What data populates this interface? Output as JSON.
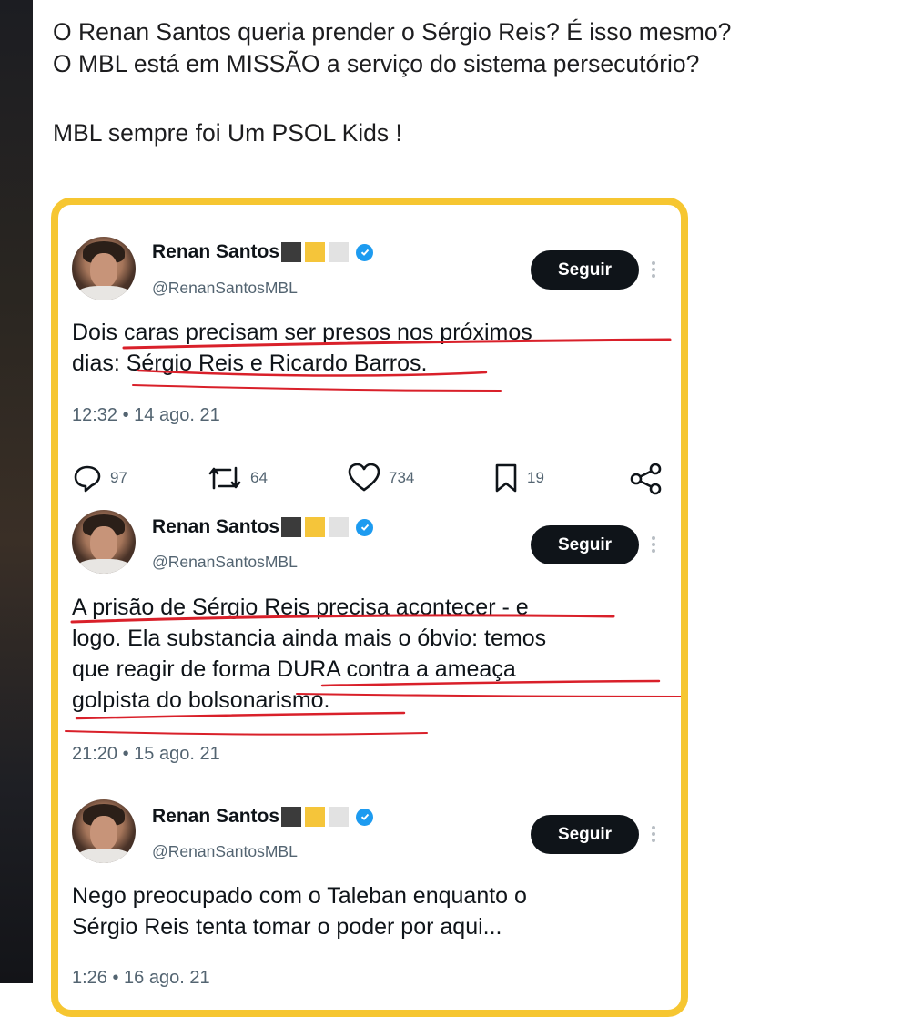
{
  "post": {
    "line1": "O Renan Santos queria prender o Sérgio Reis? É isso mesmo?",
    "line2": "O MBL está em MISSÃO a serviço do sistema persecutório?",
    "line3": "MBL sempre foi Um PSOL Kids !"
  },
  "tweets": [
    {
      "name": "Renan Santos",
      "handle": "@RenanSantosMBL",
      "follow_label": "Seguir",
      "text_line1": "Dois caras precisam ser presos nos próximos",
      "text_line2": "dias: Sérgio Reis e Ricardo Barros.",
      "timestamp": "12:32 • 14 ago. 21",
      "replies": "97",
      "retweets": "64",
      "likes": "734",
      "bookmarks": "19"
    },
    {
      "name": "Renan Santos",
      "handle": "@RenanSantosMBL",
      "follow_label": "Seguir",
      "text_line1": "A prisão de Sérgio Reis precisa acontecer - e",
      "text_line2": "logo. Ela substancia ainda mais o óbvio: temos",
      "text_line3": "que reagir de forma DURA contra a ameaça",
      "text_line4": "golpista do bolsonarismo.",
      "timestamp": "21:20 • 15 ago. 21"
    },
    {
      "name": "Renan Santos",
      "handle": "@RenanSantosMBL",
      "follow_label": "Seguir",
      "text_line1": "Nego preocupado com o Taleban enquanto o",
      "text_line2": "Sérgio Reis tenta tomar o poder por aqui...",
      "timestamp": "1:26 • 16 ago. 21"
    }
  ],
  "icons": {
    "verified": "verified-badge-icon",
    "reply": "reply-icon",
    "retweet": "retweet-icon",
    "like": "heart-icon",
    "bookmark": "bookmark-icon",
    "share": "share-icon",
    "more": "more-icon"
  },
  "colors": {
    "frame": "#f6c631",
    "verified": "#1d9bf0",
    "follow_button": "#0f1419",
    "underline": "#d9202a",
    "muted_text": "#536471"
  }
}
